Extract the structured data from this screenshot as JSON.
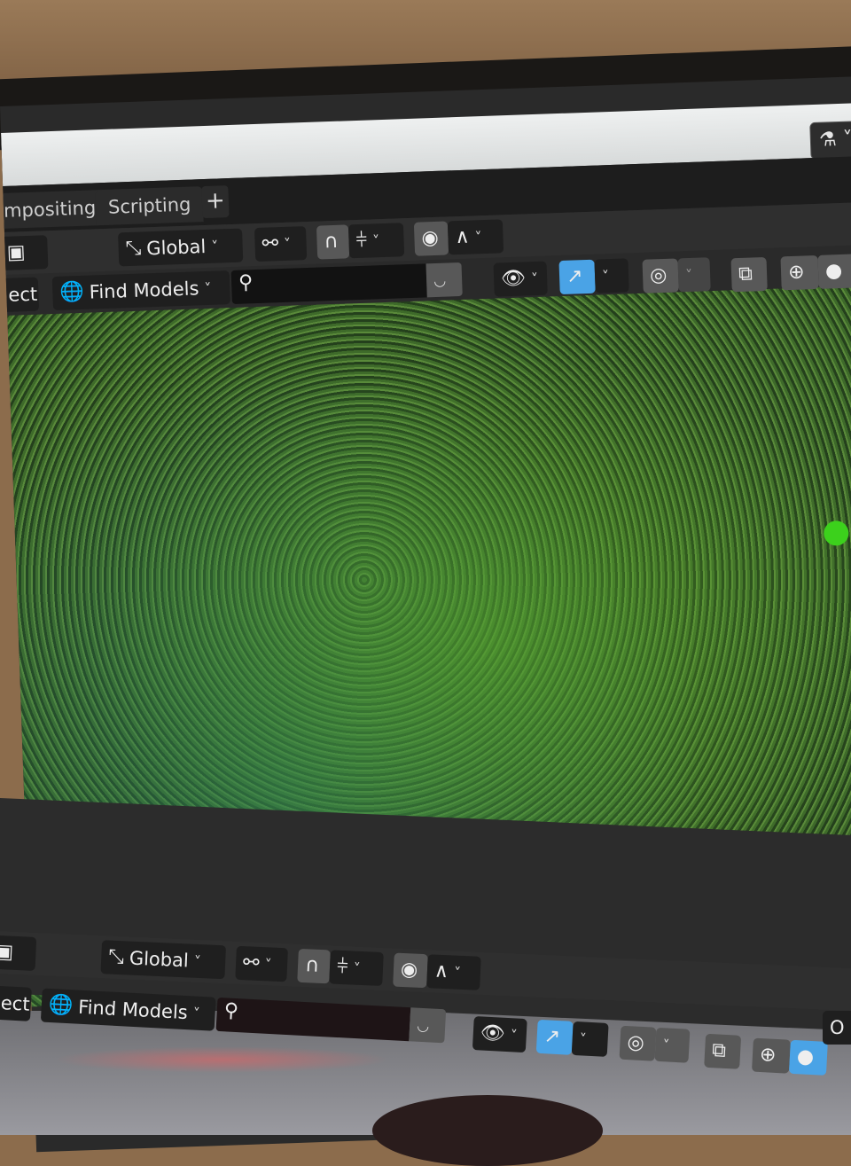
{
  "workspace_tabs": [
    {
      "label": "mpositing"
    },
    {
      "label": "Scripting"
    }
  ],
  "add_tab_label": "+",
  "top_toolbar": {
    "transform_orientation": "Global",
    "find_models_label": "Find Models",
    "select_label": "ect",
    "search_placeholder": ""
  },
  "bottom_toolbar": {
    "transform_orientation": "Global",
    "find_models_label": "Find Models",
    "select_label": "ect",
    "search_placeholder": "",
    "right_partial_label": "O"
  },
  "colors": {
    "accent_blue": "#4aa3e6",
    "gizmo_y": "#3cd11c",
    "gizmo_x": "#e0608c"
  }
}
